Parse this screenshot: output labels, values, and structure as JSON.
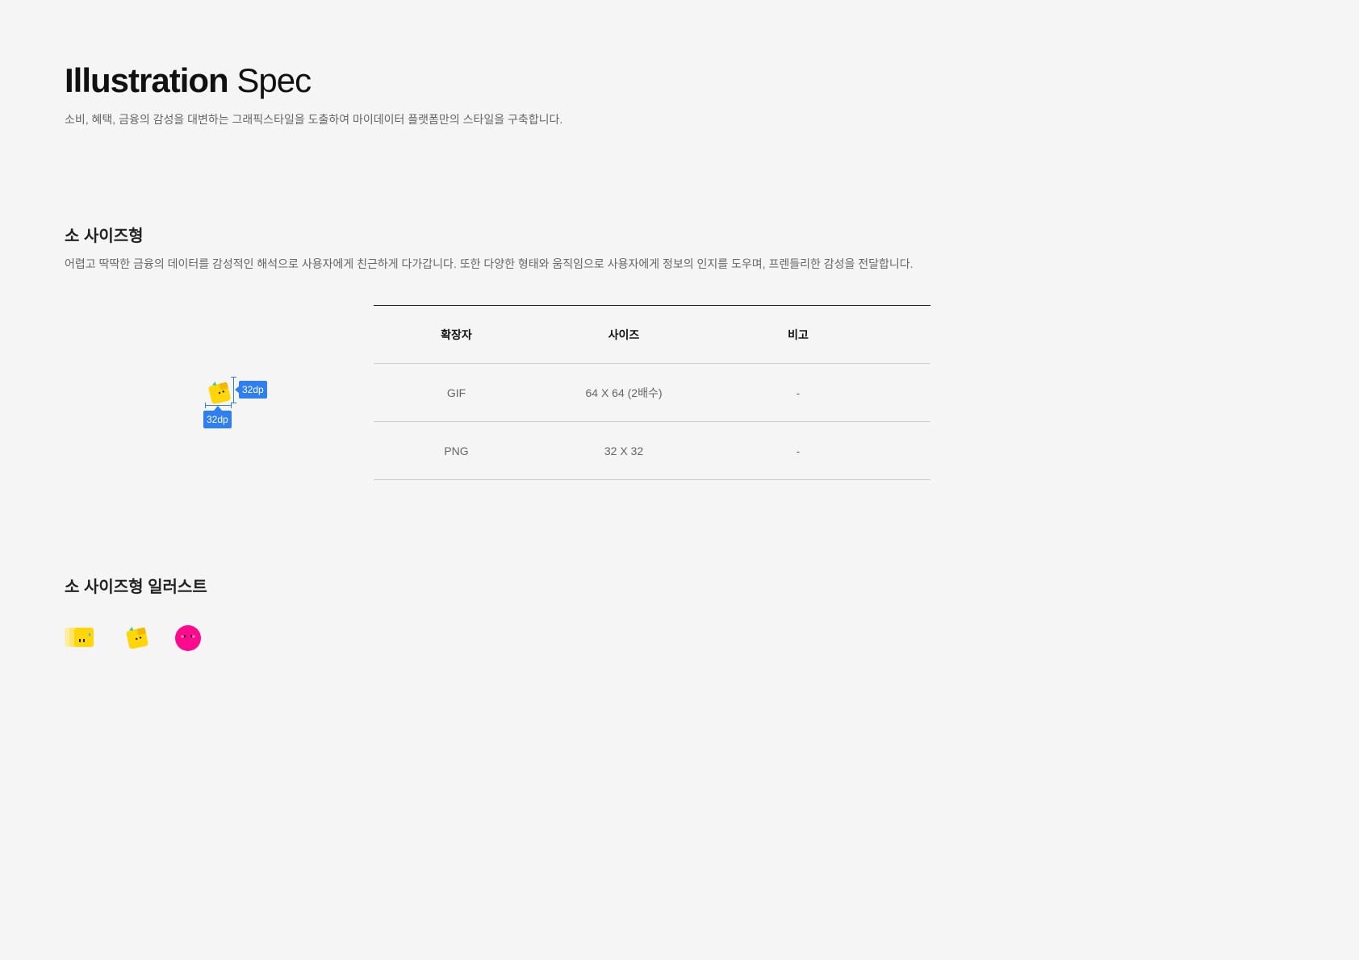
{
  "header": {
    "title_bold": "Illustration",
    "title_light": "Spec",
    "subtitle": "소비, 혜택, 금융의 감성을 대변하는 그래픽스타일을 도출하여 마이데이터 플랫폼만의 스타일을 구축합니다."
  },
  "section_small": {
    "title": "소 사이즈형",
    "description": "어렵고 딱딱한 금융의 데이터를 감성적인 해석으로 사용자에게 친근하게 다가갑니다. 또한 다양한 형태와 움직임으로 사용자에게 정보의 인지를 도우며, 프렌들리한 감성을 전달합니다.",
    "spec_height": "32dp",
    "spec_width": "32dp",
    "table": {
      "headers": [
        "확장자",
        "사이즈",
        "비고"
      ],
      "rows": [
        [
          "GIF",
          "64 X 64 (2배수)",
          "-"
        ],
        [
          "PNG",
          "32 X 32",
          "-"
        ]
      ]
    }
  },
  "section_illust": {
    "title": "소 사이즈형 일러스트"
  },
  "colors": {
    "accent_blue": "#2f7ff0",
    "yellow": "#ffd60a",
    "pink": "#ff0a8c"
  }
}
